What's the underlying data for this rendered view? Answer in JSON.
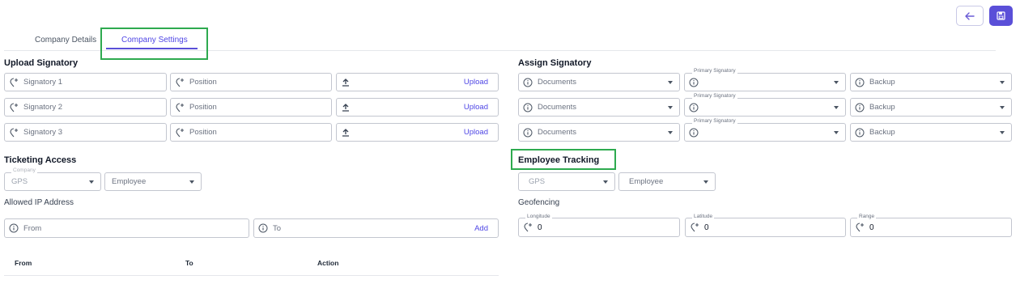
{
  "tabs": [
    {
      "label": "Company Details"
    },
    {
      "label": "Company Settings"
    }
  ],
  "upload_signatory": {
    "title": "Upload Signatory",
    "rows": [
      {
        "name_placeholder": "Signatory 1",
        "position_placeholder": "Position",
        "upload_label": "Upload"
      },
      {
        "name_placeholder": "Signatory 2",
        "position_placeholder": "Position",
        "upload_label": "Upload"
      },
      {
        "name_placeholder": "Signatory 3",
        "position_placeholder": "Position",
        "upload_label": "Upload"
      }
    ]
  },
  "assign_signatory": {
    "title": "Assign Signatory",
    "rows": [
      {
        "documents": "Documents",
        "primary_label": "Primary Signatory",
        "backup": "Backup"
      },
      {
        "documents": "Documents",
        "primary_label": "Primary Signatory",
        "backup": "Backup"
      },
      {
        "documents": "Documents",
        "primary_label": "Primary Signatory",
        "backup": "Backup"
      }
    ]
  },
  "ticketing_access": {
    "title": "Ticketing Access",
    "company_label": "Company",
    "company_value": "GPS",
    "employee_value": "Employee",
    "allowed_ip_title": "Allowed IP Address",
    "from_placeholder": "From",
    "to_placeholder": "To",
    "add_label": "Add",
    "table_headers": [
      "From",
      "To",
      "Action"
    ]
  },
  "employee_tracking": {
    "title": "Employee Tracking",
    "company_value": "GPS",
    "employee_value": "Employee",
    "geofencing_title": "Geofencing",
    "longitude_label": "Longitude",
    "longitude_value": "0",
    "latitude_label": "Latitude",
    "latitude_value": "0",
    "range_label": "Range",
    "range_value": "0"
  },
  "colors": {
    "accent": "#5a4fd8",
    "highlight": "#2eaa4f",
    "border": "#c3c6cf"
  },
  "icons": {
    "back": "arrow-left-icon",
    "save": "save-icon",
    "pin": "location-plus-icon",
    "info": "info-icon",
    "upload": "upload-icon"
  }
}
